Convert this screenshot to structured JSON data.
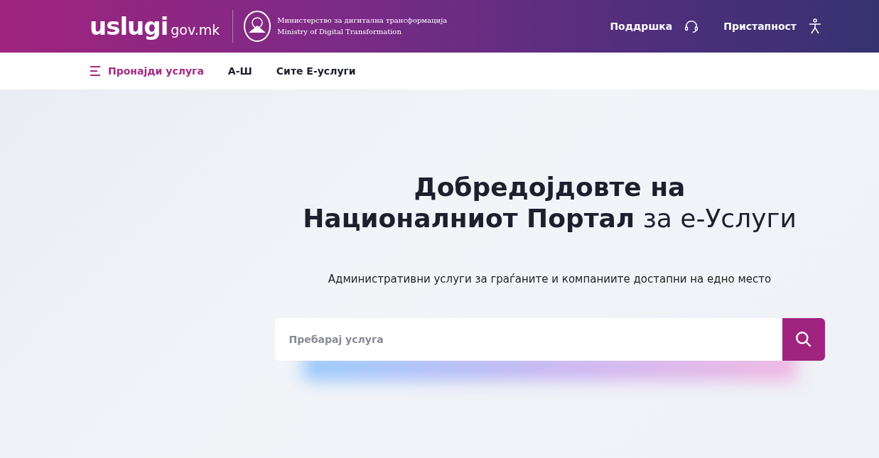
{
  "header": {
    "logo": {
      "brand": "uslugi",
      "domain": "gov.mk"
    },
    "ministry": {
      "line_1": "Министерство за дигитална трансформација",
      "line_2": "Ministry of Digital Transformation"
    },
    "links": [
      {
        "label": "Поддршка",
        "kind": "support"
      },
      {
        "label": "Пристапност",
        "kind": "accessibility"
      }
    ]
  },
  "nav": [
    {
      "label": "Пронајди услуга",
      "kind": "menu",
      "selected": true
    },
    {
      "label": "А-Ш",
      "kind": "plain",
      "selected": false
    },
    {
      "label": "Сите Е-услуги",
      "kind": "plain",
      "selected": false
    }
  ],
  "hero": {
    "title_lines": [
      "**Добредојдовте на**",
      "**Националниот Портал** за е-Услуги"
    ],
    "subtitle": "Административни услуги за граѓаните и компаниите достапни на едно место",
    "search": {
      "placeholder": "Пребарај услуга"
    }
  }
}
